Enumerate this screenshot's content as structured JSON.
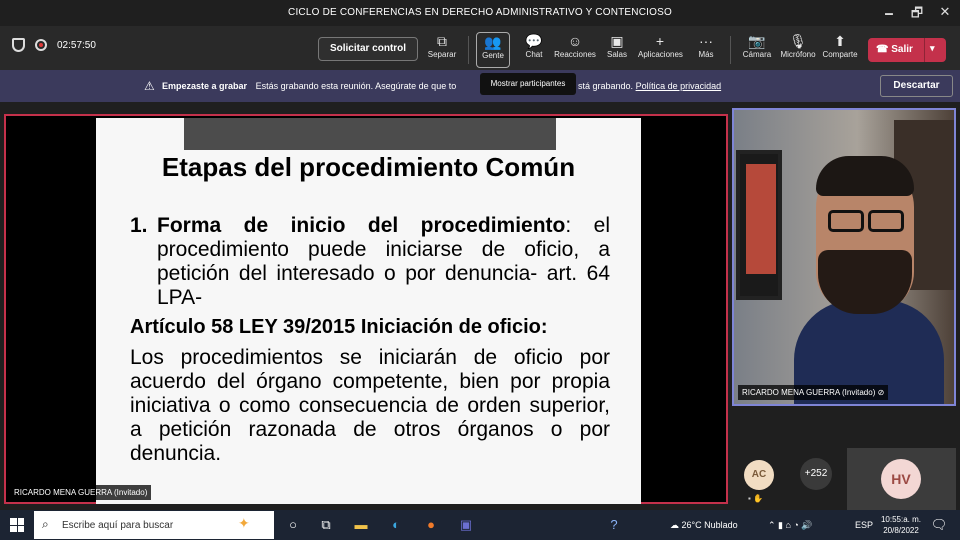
{
  "window": {
    "title": "CICLO DE CONFERENCIAS EN DERECHO ADMINISTRATIVO Y CONTENCIOSO",
    "minimize": "🗕",
    "restore": "🗗",
    "close": "✕"
  },
  "toolbar": {
    "timer": "02:57:50",
    "request_control": "Solicitar control",
    "tools": [
      {
        "label": "Separar",
        "icon": "pop-out-icon"
      },
      {
        "label": "Gente",
        "icon": "people-icon"
      },
      {
        "label": "Chat",
        "icon": "chat-icon"
      },
      {
        "label": "Reacciones",
        "icon": "reactions-icon"
      },
      {
        "label": "Salas",
        "icon": "rooms-icon"
      },
      {
        "label": "Aplicaciones",
        "icon": "apps-icon"
      },
      {
        "label": "Más",
        "icon": "more-icon"
      },
      {
        "label": "Cámara",
        "icon": "camera-off-icon"
      },
      {
        "label": "Micrófono",
        "icon": "mic-off-icon"
      },
      {
        "label": "Comparte",
        "icon": "share-icon"
      }
    ],
    "leave": "Salir",
    "tooltip": "Mostrar participantes"
  },
  "banner": {
    "bold": "Empezaste a grabar",
    "text": "Estás grabando esta reunión. Asegúrate de que to",
    "text_tail": "stá grabando.",
    "link": "Política de privacidad",
    "dismiss": "Descartar"
  },
  "slide": {
    "title": "Etapas del  procedimiento Común",
    "item_number": "1.",
    "item_bold": "Forma de inicio del procedimiento",
    "item_text": ": el procedimiento puede iniciarse de oficio, a petición del interesado o por denuncia- art. 64 LPA-",
    "article_heading": "Artículo 58 LEY 39/2015 Iniciación de oficio:",
    "article_text": "Los procedimientos se iniciarán de oficio por acuerdo del órgano competente, bien por propia iniciativa o como consecuencia de orden superior, a petición razonada de otros órganos o por denuncia."
  },
  "presenter_tag": "RICARDO MENA GUERRA (Invitado)",
  "camera": {
    "name": "RICARDO MENA GUERRA (Invitado)"
  },
  "participants": {
    "ac": "AC",
    "more": "+252",
    "hv": "HV"
  },
  "taskbar": {
    "search_placeholder": "Escribe aquí para buscar",
    "weather": "26°C  Nublado",
    "lang": "ESP",
    "time": "10:55:a. m.",
    "date": "20/8/2022"
  }
}
